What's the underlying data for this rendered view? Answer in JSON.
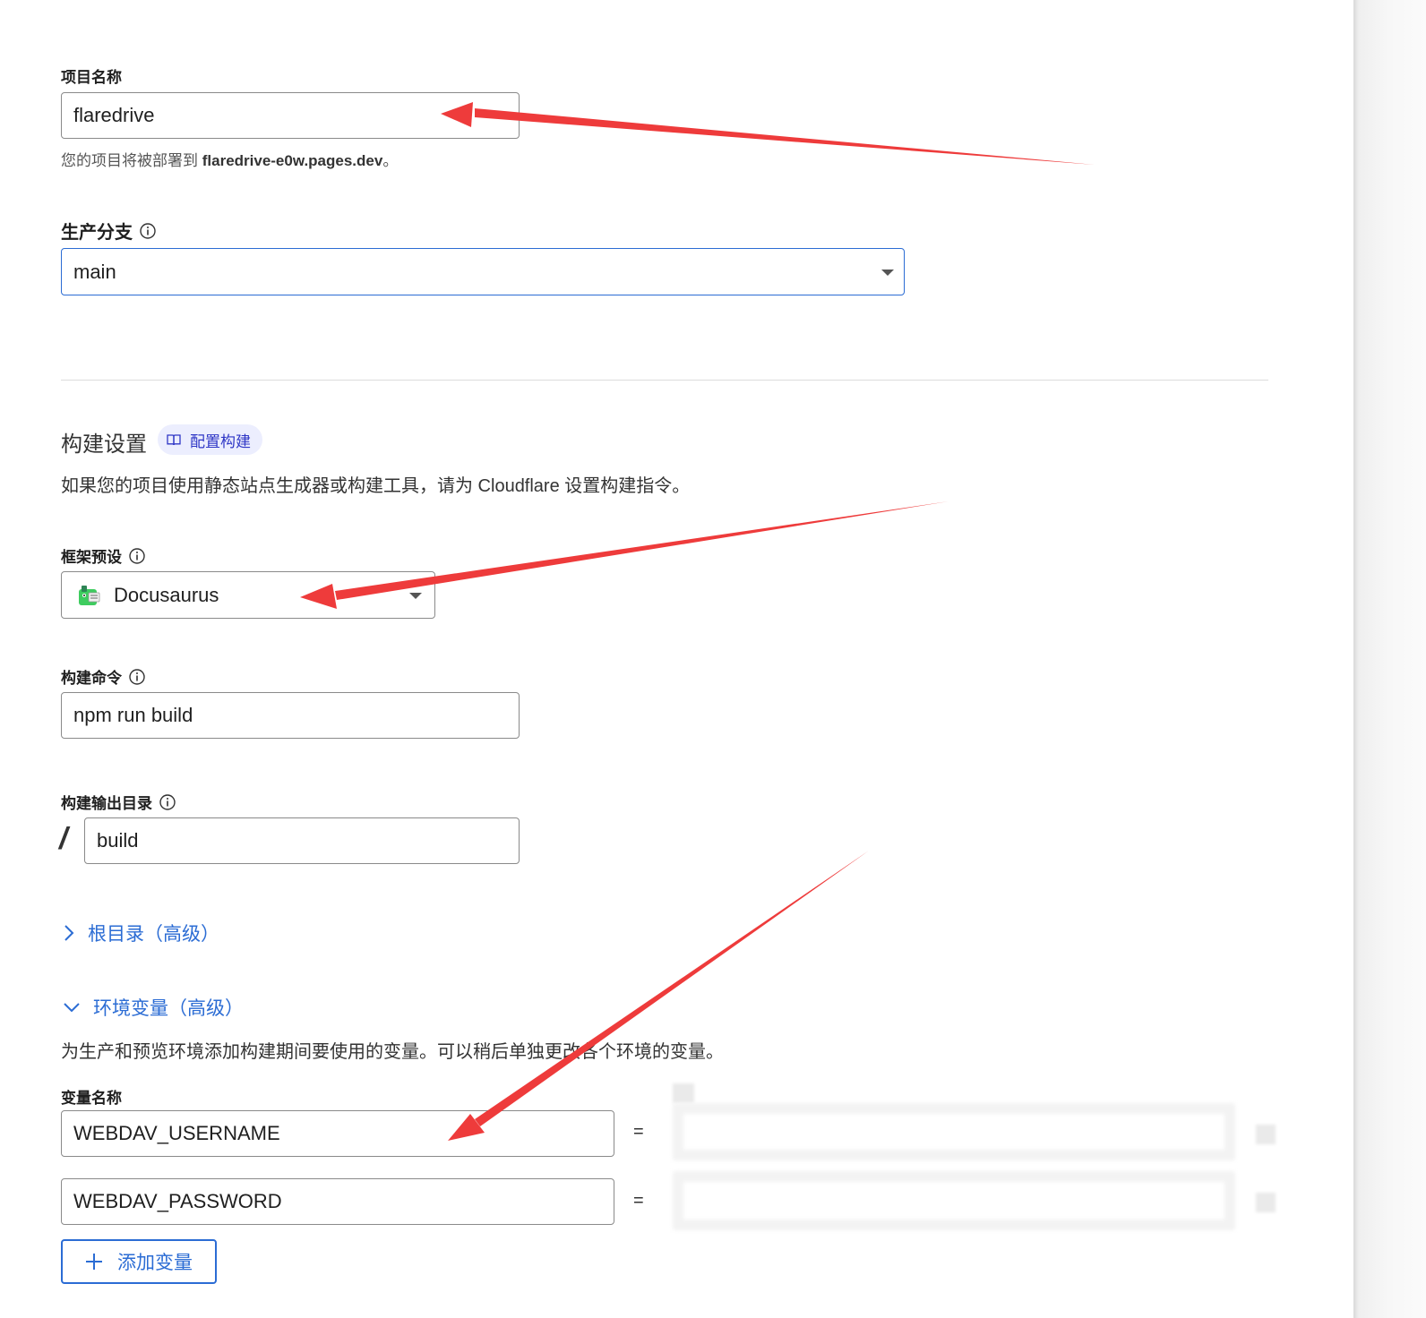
{
  "project": {
    "label": "项目名称",
    "value": "flaredrive",
    "deploy_hint_prefix": "您的项目将被部署到 ",
    "deploy_hint_domain": "flaredrive-e0w.pages.dev",
    "deploy_hint_suffix": "。"
  },
  "branch": {
    "label": "生产分支",
    "value": "main"
  },
  "build_settings": {
    "title": "构建设置",
    "chip_label": "配置构建",
    "description": "如果您的项目使用静态站点生成器或构建工具，请为 Cloudflare 设置构建指令。"
  },
  "framework": {
    "label": "框架预设",
    "value": "Docusaurus"
  },
  "build_command": {
    "label": "构建命令",
    "value": "npm run build"
  },
  "output_dir": {
    "label": "构建输出目录",
    "prefix": "/",
    "value": "build"
  },
  "root_dir": {
    "label": "根目录（高级）"
  },
  "env_vars": {
    "label": "环境变量（高级）",
    "description": "为生产和预览环境添加构建期间要使用的变量。可以稍后单独更改各个环境的变量。",
    "name_header": "变量名称",
    "equals": "=",
    "rows": [
      {
        "name": "WEBDAV_USERNAME"
      },
      {
        "name": "WEBDAV_PASSWORD"
      }
    ],
    "add_button": "添加变量"
  },
  "colors": {
    "accent": "#2b6cd4",
    "annotation_arrow": "#ee3b3b"
  }
}
